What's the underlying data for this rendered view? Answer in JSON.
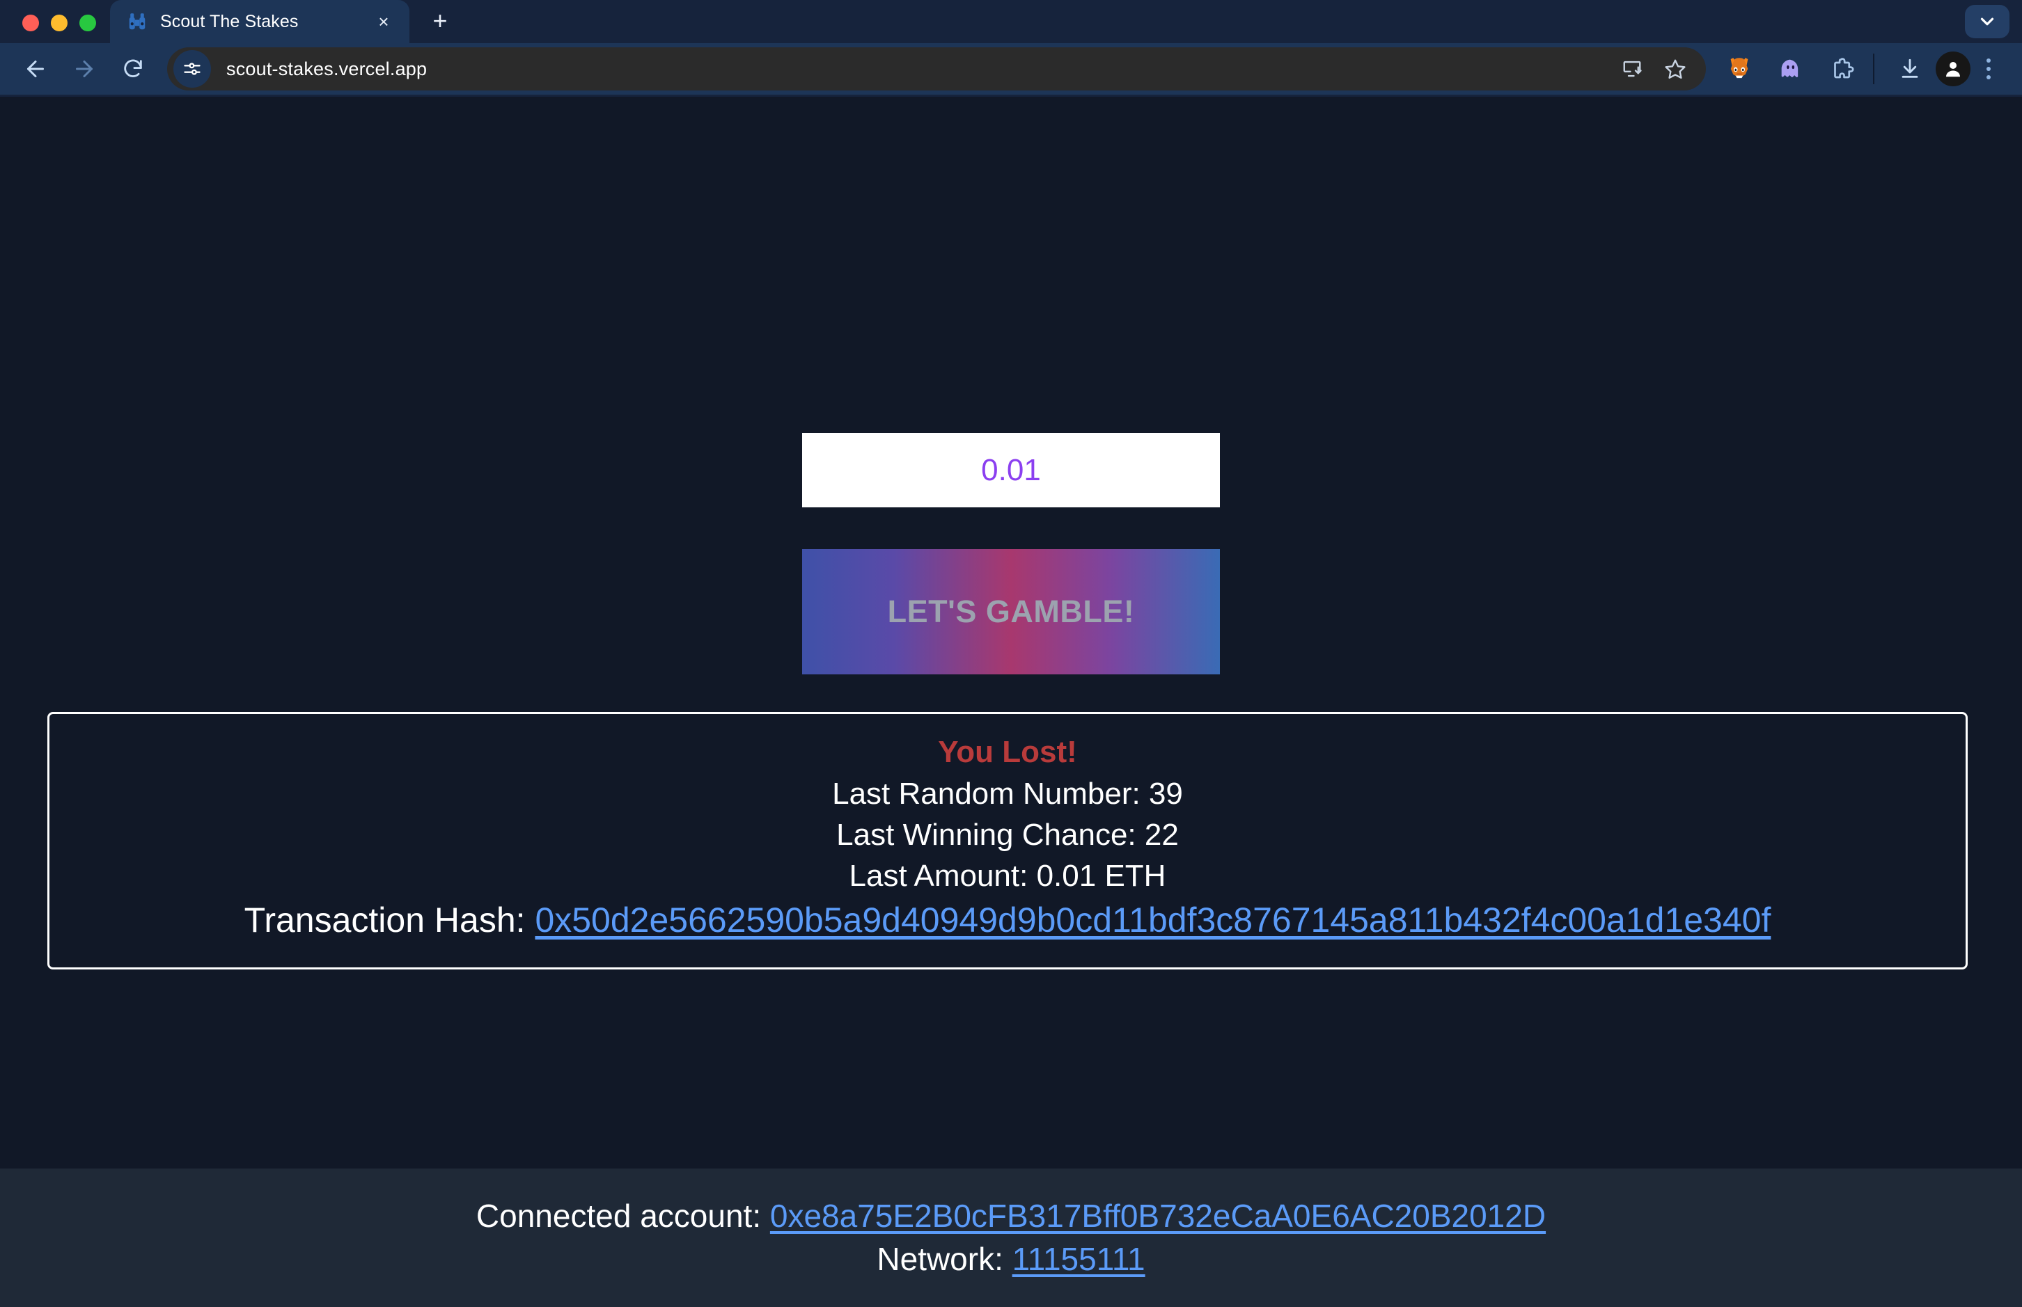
{
  "browser": {
    "window_controls": [
      "close",
      "minimize",
      "maximize"
    ],
    "tab": {
      "title": "Scout The Stakes",
      "favicon_name": "scout-binoculars-favicon",
      "close_label": "×"
    },
    "new_tab_label": "+",
    "collapse_label": "chevron-down",
    "toolbar": {
      "back_label": "back",
      "forward_label": "forward",
      "reload_label": "reload",
      "url": "scout-stakes.vercel.app",
      "site_settings_icon": "tune-sliders-icon",
      "install_icon": "install-app-icon",
      "bookmark_icon": "star-icon",
      "extensions": [
        {
          "name": "metamask-extension-icon",
          "glyph": "🦊"
        },
        {
          "name": "phantom-wallet-extension-icon",
          "glyph": "👻"
        },
        {
          "name": "extensions-puzzle-icon",
          "glyph": "puzzle"
        }
      ],
      "downloads_icon": "download-icon",
      "profile_icon": "profile-avatar-icon",
      "menu_icon": "kebab-menu-icon"
    }
  },
  "app": {
    "bet_amount_value": "0.01",
    "bet_amount_placeholder": "0.0",
    "gamble_button_label": "LET'S GAMBLE!",
    "result": {
      "status": "You Lost!",
      "random_number_line": "Last Random Number: 39",
      "winning_chance_line": "Last Winning Chance: 22",
      "amount_line": "Last Amount: 0.01 ETH",
      "tx_hash_label": "Transaction Hash: ",
      "tx_hash_value": "0x50d2e5662590b5a9d40949d9b0cd11bdf3c8767145a811b432f4c00a1d1e340f",
      "random_number": "39",
      "winning_chance": "22",
      "amount_eth": "0.01 ETH"
    },
    "footer": {
      "account_label": "Connected account: ",
      "account_value": "0xe8a75E2B0cFB317Bff0B732eCaA0E6AC20B2012D",
      "network_label": "Network: ",
      "network_value": "11155111"
    }
  },
  "colors": {
    "page_bg": "#111827",
    "footer_bg": "#1f2937",
    "chrome_bg": "#1d3557",
    "titlebar_bg": "#16233c",
    "lost_red": "#b93b3b",
    "link_blue": "#5b9bf8",
    "input_purple": "#8b3ff0",
    "button_text": "#9ca3af"
  }
}
